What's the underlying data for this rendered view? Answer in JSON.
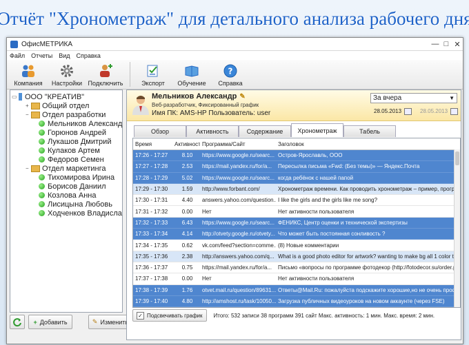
{
  "headline": "Отчёт \"Хронометраж\" для детального анализа рабочего дня",
  "window": {
    "title": "ОфисМЕТРИКА",
    "controls": [
      "—",
      "□",
      "✕"
    ]
  },
  "menu": [
    "Файл",
    "Отчеты",
    "Вид",
    "Справка"
  ],
  "toolbar": {
    "company": "Компания",
    "settings": "Настройки",
    "connect": "Подключить",
    "export": "Экспорт",
    "training": "Обучение",
    "help": "Справка"
  },
  "tree": {
    "org": "ООО \"КРЕАТИВ\"",
    "dept_general": "Общий отдел",
    "dept_dev": "Отдел разработки",
    "dev_people": [
      "Мельников Александр",
      "Горюнов Андрей",
      "Лукашов Дмитрий",
      "Кулаков Артем",
      "Федоров Семен"
    ],
    "dept_marketing": "Отдел маркетинга",
    "mkt_people": [
      "Тихомирова Ирина",
      "Борисов Даниил",
      "Козлова Анна",
      "Лисицына Любовь",
      "Ходченков Владислав"
    ]
  },
  "buttons": {
    "add": "Добавить",
    "edit": "Изменить"
  },
  "user": {
    "name": "Мельников Александр",
    "role": "Веб-разработчик, Фиксированный график",
    "pc": "Имя ПК: AMS-HP Пользователь: user"
  },
  "period": {
    "selected": "За вчера",
    "date_from": "28.05.2013",
    "date_to": "28.05.2013"
  },
  "tabs": [
    "Обзор",
    "Активность",
    "Содержание",
    "Хронометраж",
    "Табель"
  ],
  "table": {
    "headers": [
      "Время",
      "Активность",
      "Программа/Сайт",
      "Заголовок"
    ],
    "rows": [
      {
        "time": "17:26 - 17:27",
        "act": "8.10",
        "prog": "https://www.google.ru/searc...",
        "title": "Остров-Ярославль, ООО",
        "style": "sel"
      },
      {
        "time": "17:27 - 17:28",
        "act": "2.53",
        "prog": "https://mail.yandex.ru/for/a...",
        "title": "Пересылка письма «Fwd: (Без темы)» — Яндекс.Почта",
        "style": "sel"
      },
      {
        "time": "17:28 - 17:29",
        "act": "5.02",
        "prog": "https://www.google.ru/searc...",
        "title": "когда ребёнок с нашей папой",
        "style": "sel"
      },
      {
        "time": "17:29 - 17:30",
        "act": "1.59",
        "prog": "http://www.forbant.com/",
        "title": "Хронометраж времени. Как проводить хронометраж – пример, программа",
        "style": "lite"
      },
      {
        "time": "17:30 - 17:31",
        "act": "4.40",
        "prog": "answers.yahoo.com/question...",
        "title": "I like the girls and the girls like me song?",
        "style": ""
      },
      {
        "time": "17:31 - 17:32",
        "act": "0.00",
        "prog": "Нет",
        "title": "Нет активности пользователя",
        "style": ""
      },
      {
        "time": "17:32 - 17:33",
        "act": "6.43",
        "prog": "https://www.google.ru/searc...",
        "title": "ФЕНИКС, Центр оценки и технической экспертизы",
        "style": "sel"
      },
      {
        "time": "17:33 - 17:34",
        "act": "4.14",
        "prog": "http://otvety.google.ru/otvety...",
        "title": "Что может быть постоянная сонливость ?",
        "style": "sel"
      },
      {
        "time": "17:34 - 17:35",
        "act": "0.62",
        "prog": "vk.com/feed?section=comme...",
        "title": "(8) Новые комментарии",
        "style": ""
      },
      {
        "time": "17:35 - 17:36",
        "act": "2.38",
        "prog": "http://answers.yahoo.com/q...",
        "title": "What is a good photo editor for artwork? wanting to make bg all 1 color to lo",
        "style": "lite"
      },
      {
        "time": "17:36 - 17:37",
        "act": "0.75",
        "prog": "https://mail.yandex.ru/for/a...",
        "title": "Письмо «вопросы по программе фотодекор (http://fotodecor.su/order.php)",
        "style": ""
      },
      {
        "time": "17:37 - 17:38",
        "act": "0.00",
        "prog": "Нет",
        "title": "Нет активности пользователя",
        "style": ""
      },
      {
        "time": "17:38 - 17:39",
        "act": "1.76",
        "prog": "otvet.mail.ru/question/89631...",
        "title": "Ответы@Mail.Ru: пожалуйста подскажите хорошие,но не очень професси",
        "style": "sel"
      },
      {
        "time": "17:39 - 17:40",
        "act": "4.80",
        "prog": "http://amshost.ru/task/10050...",
        "title": "Загрузка публичных видеоуроков на новом аккаунте (через FSE)",
        "style": "sel"
      },
      {
        "time": "17:40 - 17:41",
        "act": "6.19",
        "prog": "g2.botva.ru/harbour.php?s...",
        "title": "Услуги. Ботва Онлайн | Битва за реальную капусту!",
        "style": "sel"
      },
      {
        "time": "17:41 - 17:42",
        "act": "5.55",
        "prog": "ru.wikipedia.org/wiki/Кэррол...",
        "title": "Кэрролл, Джим — Википедия",
        "style": "sel"
      }
    ]
  },
  "footer": {
    "highlight": "Подсвечивать график",
    "summary": "Итого: 532 записи 38 программ 391 сайт  Макс. активность: 1 мин.  Макс. время: 2 мин."
  }
}
